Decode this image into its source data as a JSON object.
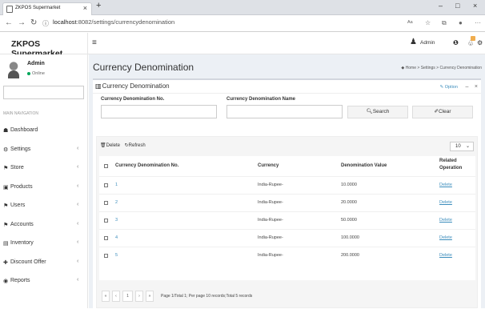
{
  "browser": {
    "tab_title": "ZKPOS Supermarket",
    "tab_close": "×",
    "new_tab": "+",
    "url_host": "localhost",
    "url_rest": ":8082/settings/currencydenomination",
    "win_min": "–",
    "win_max": "□",
    "win_close": "×"
  },
  "app": {
    "brand": "ZKPOS Supermarket",
    "admin_label": "Admin"
  },
  "sidebar": {
    "user_name": "Admin",
    "user_status": "Online",
    "nav_header": "MAIN NAVIGATION",
    "items": [
      {
        "label": "Dashboard",
        "icon": "☗",
        "has_children": false
      },
      {
        "label": "Settings",
        "icon": "⚙",
        "has_children": true
      },
      {
        "label": "Store",
        "icon": "⚑",
        "has_children": true
      },
      {
        "label": "Products",
        "icon": "▣",
        "has_children": true
      },
      {
        "label": "Users",
        "icon": "⚑",
        "has_children": true
      },
      {
        "label": "Accounts",
        "icon": "⚑",
        "has_children": true
      },
      {
        "label": "Inventory",
        "icon": "▤",
        "has_children": true
      },
      {
        "label": "Discount Offer",
        "icon": "✚",
        "has_children": true
      },
      {
        "label": "Reports",
        "icon": "◉",
        "has_children": true
      }
    ],
    "chevron": "‹"
  },
  "page": {
    "title": "Currency Denomination",
    "breadcrumb": [
      "Home",
      "Settings",
      "Currency Denomination"
    ],
    "box_title": "Currency Denomination",
    "options_label": "Option",
    "minimize": "–",
    "close": "×"
  },
  "filters": {
    "no_label": "Currency Denomination No.",
    "name_label": "Currency Denomination Name",
    "search_label": "Search",
    "clear_label": "Clear"
  },
  "toolbar": {
    "delete_label": "Delete",
    "refresh_label": "Refresh",
    "page_size": "10"
  },
  "table": {
    "headers": [
      "Currency Denomination No.",
      "Currency",
      "Denomination Value",
      "Related Operation"
    ],
    "rows": [
      {
        "no": "1",
        "currency": "India-Rupee-",
        "value": "10.0000",
        "op": "Delete"
      },
      {
        "no": "2",
        "currency": "India-Rupee-",
        "value": "20.0000",
        "op": "Delete"
      },
      {
        "no": "3",
        "currency": "India-Rupee-",
        "value": "50.0000",
        "op": "Delete"
      },
      {
        "no": "4",
        "currency": "India-Rupee-",
        "value": "100.0000",
        "op": "Delete"
      },
      {
        "no": "5",
        "currency": "India-Rupee-",
        "value": "200.0000",
        "op": "Delete"
      }
    ]
  },
  "pager": {
    "first": "«",
    "prev": "‹",
    "current": "1",
    "next": "›",
    "last": "»",
    "info": "Page 1/Total 1; Per page 10 records;Total 5 records"
  }
}
